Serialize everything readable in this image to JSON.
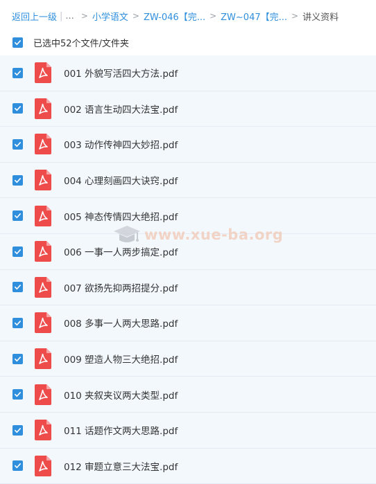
{
  "breadcrumb": {
    "back": "返回上一级",
    "separator": "|",
    "ellipsis": "...",
    "items": [
      "小学语文",
      "ZW-046【完...",
      "ZW~047【完..."
    ],
    "current": "讲义资料"
  },
  "selection": {
    "label": "已选中52个文件/文件夹",
    "checked": true
  },
  "files": [
    {
      "name": "001 外貌写活四大方法.pdf",
      "checked": true
    },
    {
      "name": "002 语言生动四大法宝.pdf",
      "checked": true
    },
    {
      "name": "003 动作传神四大妙招.pdf",
      "checked": true
    },
    {
      "name": "004 心理刻画四大诀窍.pdf",
      "checked": true
    },
    {
      "name": "005 神态传情四大绝招.pdf",
      "checked": true
    },
    {
      "name": "006 一事一人两步搞定.pdf",
      "checked": true
    },
    {
      "name": "007 欲扬先抑两招提分.pdf",
      "checked": true
    },
    {
      "name": "008 多事一人两大思路.pdf",
      "checked": true
    },
    {
      "name": "009 塑造人物三大绝招.pdf",
      "checked": true
    },
    {
      "name": "010 夹叙夹议两大类型.pdf",
      "checked": true
    },
    {
      "name": "011 话题作文两大思路.pdf",
      "checked": true
    },
    {
      "name": "012 审题立意三大法宝.pdf",
      "checked": true
    }
  ],
  "watermark": "www.xue-ba.org",
  "colors": {
    "accent": "#2f8fdd",
    "pdf_icon": "#ee4b4b",
    "row_bg": "#f3f8fd"
  },
  "icons": {
    "checkbox": "checkbox-checked-icon",
    "file": "pdf-file-icon",
    "watermark": "graduation-cap-icon"
  }
}
